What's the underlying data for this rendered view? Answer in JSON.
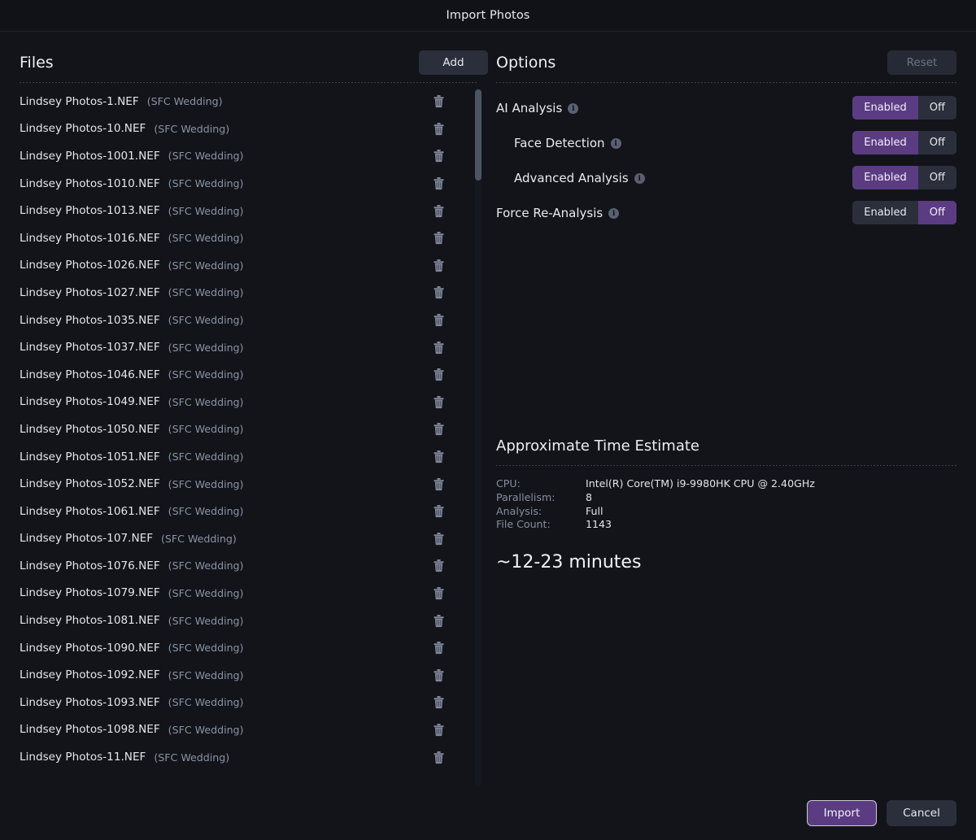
{
  "window": {
    "title": "Import Photos"
  },
  "colors": {
    "background": "#121419",
    "titlebar": "#101218",
    "accent": "#5b3c82",
    "button": "#2b2f3c",
    "text": "#e8eaf0",
    "muted": "#8c93a6"
  },
  "files_panel": {
    "title": "Files",
    "add_label": "Add",
    "delete_icon": "trash-icon",
    "items": [
      {
        "name": "Lindsey Photos-1.NEF",
        "tag": "(SFC Wedding)"
      },
      {
        "name": "Lindsey Photos-10.NEF",
        "tag": "(SFC Wedding)"
      },
      {
        "name": "Lindsey Photos-1001.NEF",
        "tag": "(SFC Wedding)"
      },
      {
        "name": "Lindsey Photos-1010.NEF",
        "tag": "(SFC Wedding)"
      },
      {
        "name": "Lindsey Photos-1013.NEF",
        "tag": "(SFC Wedding)"
      },
      {
        "name": "Lindsey Photos-1016.NEF",
        "tag": "(SFC Wedding)"
      },
      {
        "name": "Lindsey Photos-1026.NEF",
        "tag": "(SFC Wedding)"
      },
      {
        "name": "Lindsey Photos-1027.NEF",
        "tag": "(SFC Wedding)"
      },
      {
        "name": "Lindsey Photos-1035.NEF",
        "tag": "(SFC Wedding)"
      },
      {
        "name": "Lindsey Photos-1037.NEF",
        "tag": "(SFC Wedding)"
      },
      {
        "name": "Lindsey Photos-1046.NEF",
        "tag": "(SFC Wedding)"
      },
      {
        "name": "Lindsey Photos-1049.NEF",
        "tag": "(SFC Wedding)"
      },
      {
        "name": "Lindsey Photos-1050.NEF",
        "tag": "(SFC Wedding)"
      },
      {
        "name": "Lindsey Photos-1051.NEF",
        "tag": "(SFC Wedding)"
      },
      {
        "name": "Lindsey Photos-1052.NEF",
        "tag": "(SFC Wedding)"
      },
      {
        "name": "Lindsey Photos-1061.NEF",
        "tag": "(SFC Wedding)"
      },
      {
        "name": "Lindsey Photos-107.NEF",
        "tag": "(SFC Wedding)"
      },
      {
        "name": "Lindsey Photos-1076.NEF",
        "tag": "(SFC Wedding)"
      },
      {
        "name": "Lindsey Photos-1079.NEF",
        "tag": "(SFC Wedding)"
      },
      {
        "name": "Lindsey Photos-1081.NEF",
        "tag": "(SFC Wedding)"
      },
      {
        "name": "Lindsey Photos-1090.NEF",
        "tag": "(SFC Wedding)"
      },
      {
        "name": "Lindsey Photos-1092.NEF",
        "tag": "(SFC Wedding)"
      },
      {
        "name": "Lindsey Photos-1093.NEF",
        "tag": "(SFC Wedding)"
      },
      {
        "name": "Lindsey Photos-1098.NEF",
        "tag": "(SFC Wedding)"
      },
      {
        "name": "Lindsey Photos-11.NEF",
        "tag": "(SFC Wedding)"
      }
    ]
  },
  "options_panel": {
    "title": "Options",
    "reset_label": "Reset",
    "reset_disabled": true,
    "toggle_on_label": "Enabled",
    "toggle_off_label": "Off",
    "info_icon": "info-icon",
    "rows": [
      {
        "label": "AI Analysis",
        "indented": false,
        "selected": "on"
      },
      {
        "label": "Face Detection",
        "indented": true,
        "selected": "on"
      },
      {
        "label": "Advanced Analysis",
        "indented": true,
        "selected": "on"
      },
      {
        "label": "Force Re-Analysis",
        "indented": false,
        "selected": "off"
      }
    ]
  },
  "estimate": {
    "title": "Approximate Time Estimate",
    "rows": [
      {
        "key": "CPU:",
        "value": "Intel(R) Core(TM) i9-9980HK CPU @ 2.40GHz"
      },
      {
        "key": "Parallelism:",
        "value": "8"
      },
      {
        "key": "Analysis:",
        "value": "Full"
      },
      {
        "key": "File Count:",
        "value": "1143"
      }
    ],
    "total": "~12-23 minutes"
  },
  "footer": {
    "import_label": "Import",
    "cancel_label": "Cancel"
  }
}
